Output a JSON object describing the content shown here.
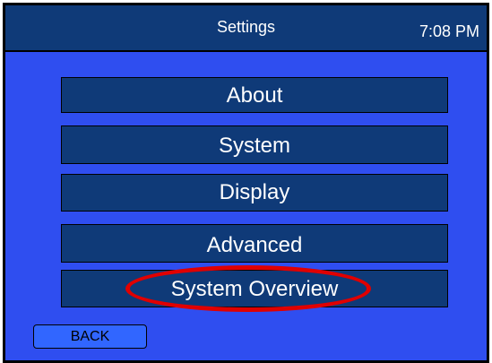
{
  "header": {
    "title": "Settings",
    "time": "7:08 PM"
  },
  "menu": {
    "items": [
      {
        "label": "About"
      },
      {
        "label": "System"
      },
      {
        "label": "Display"
      },
      {
        "label": "Advanced"
      },
      {
        "label": "System Overview",
        "highlighted": true
      }
    ]
  },
  "footer": {
    "back_label": "BACK"
  },
  "colors": {
    "screen_background": "#2f4ef0",
    "button_background": "#0f3a78",
    "back_button": "#3166ff",
    "highlight": "#e00000"
  }
}
